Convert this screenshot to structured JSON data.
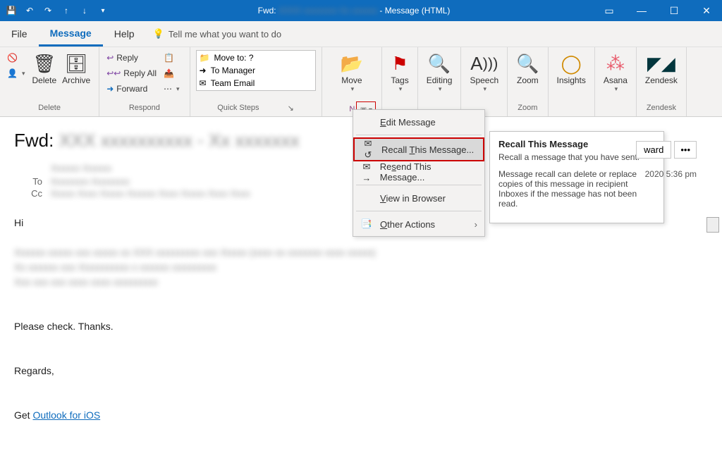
{
  "title": {
    "prefix": "Fwd:",
    "suffix": "- Message (HTML)"
  },
  "menutabs": {
    "file": "File",
    "message": "Message",
    "help": "Help"
  },
  "tellme": "Tell me what you want to do",
  "ribbon": {
    "delete": {
      "label": "Delete",
      "delete": "Delete",
      "archive": "Archive"
    },
    "respond": {
      "label": "Respond",
      "reply": "Reply",
      "replyall": "Reply All",
      "forward": "Forward"
    },
    "quicksteps": {
      "label": "Quick Steps",
      "moveto": "Move to: ?",
      "tomanager": "To Manager",
      "teamemail": "Team Email"
    },
    "move": {
      "label": "Move",
      "move": "Move"
    },
    "tags": {
      "label": "Tags"
    },
    "editing": {
      "label": "Editing"
    },
    "speech": {
      "label": "Speech"
    },
    "zoom": {
      "label": "Zoom",
      "btn": "Zoom"
    },
    "insights": {
      "label": "Insights"
    },
    "asana": {
      "label": "Asana"
    },
    "zendesk": {
      "label": "Zendesk",
      "btn": "Zendesk"
    }
  },
  "actionsmenu": {
    "edit": "Edit Message",
    "recall": "Recall This Message...",
    "resend": "Resend This Message...",
    "viewbrowser": "View in Browser",
    "other": "Other Actions"
  },
  "tooltip": {
    "title": "Recall This Message",
    "p1": "Recall a message that you have sent.",
    "p2": "Message recall can delete or replace copies of this message in recipient Inboxes if the message has not been read."
  },
  "message": {
    "subject_prefix": "Fwd:",
    "to_label": "To",
    "cc_label": "Cc",
    "date": "2020 5:36 pm",
    "forward_btn": "ward",
    "more_btn": "•••"
  },
  "body": {
    "hi": "Hi",
    "please": "Please check. Thanks.",
    "regards": "Regards,",
    "get": "Get ",
    "outlook": "Outlook for iOS"
  }
}
